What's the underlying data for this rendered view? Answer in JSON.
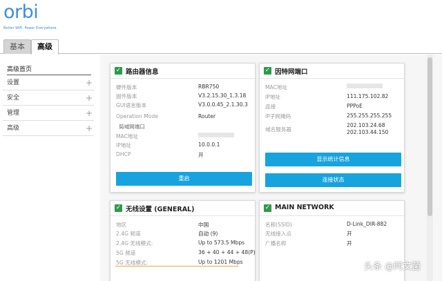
{
  "brand": {
    "logo": "orbi",
    "tagline": "Better WiFi. Fewer Everywhere."
  },
  "tabs": {
    "basic": "基本",
    "advanced": "高级"
  },
  "sidebar": {
    "home": "高级首页",
    "items": [
      {
        "label": "设置"
      },
      {
        "label": "安全"
      },
      {
        "label": "管理"
      },
      {
        "label": "高级"
      }
    ]
  },
  "router_info": {
    "title": "路由器信息",
    "rows": [
      {
        "label": "硬件版本",
        "value": "RBR750"
      },
      {
        "label": "固件版本",
        "value": "V3.2.15.30_1.3.18"
      },
      {
        "label": "GUI语言版本",
        "value": "V3.0.0.45_2.1.30.3"
      },
      {
        "label": "Operation Mode",
        "value": "Router"
      },
      {
        "label": "局域网端口",
        "value": ""
      },
      {
        "label": "MAC地址",
        "value": ""
      },
      {
        "label": "IP地址",
        "value": "10.0.0.1"
      },
      {
        "label": "DHCP",
        "value": "开"
      }
    ],
    "reboot_button": "重启"
  },
  "internet_port": {
    "title": "因特网端口",
    "rows": [
      {
        "label": "MAC地址",
        "value": ""
      },
      {
        "label": "IP地址",
        "value": "111.175.102.82"
      },
      {
        "label": "连接",
        "value": "PPPoE"
      },
      {
        "label": "IP子网掩码",
        "value": "255.255.255.255"
      },
      {
        "label": "域名服务器",
        "value": "202.103.24.68"
      },
      {
        "label": "",
        "value": "202.103.44.150"
      }
    ],
    "stats_button": "显示统计信息",
    "status_button": "连接状态"
  },
  "wireless": {
    "title": "无线设置 (GENERAL)",
    "rows": [
      {
        "label": "地区",
        "value": "中国"
      },
      {
        "label": "2.4G 频道",
        "value": "自动 (9)"
      },
      {
        "label": "2.4G 无线模式:",
        "value": "Up to 573.5 Mbps"
      },
      {
        "label": "5G 频道",
        "value": "36 + 40 + 44 + 48(P)"
      },
      {
        "label": "5G 无线模式:",
        "value": "Up to 1201 Mbps"
      }
    ]
  },
  "main_network": {
    "title": "MAIN NETWORK",
    "rows": [
      {
        "label": "名称(SSID)",
        "value": "D-Link_DIR-882"
      },
      {
        "label": "无线接入点",
        "value": "开"
      },
      {
        "label": "广播名称",
        "value": "开"
      }
    ]
  },
  "watermark": "头条 @阿文菌",
  "colors": {
    "accent": "#17a3de",
    "check": "#2e9a4a",
    "brand": "#3d8fd6"
  }
}
